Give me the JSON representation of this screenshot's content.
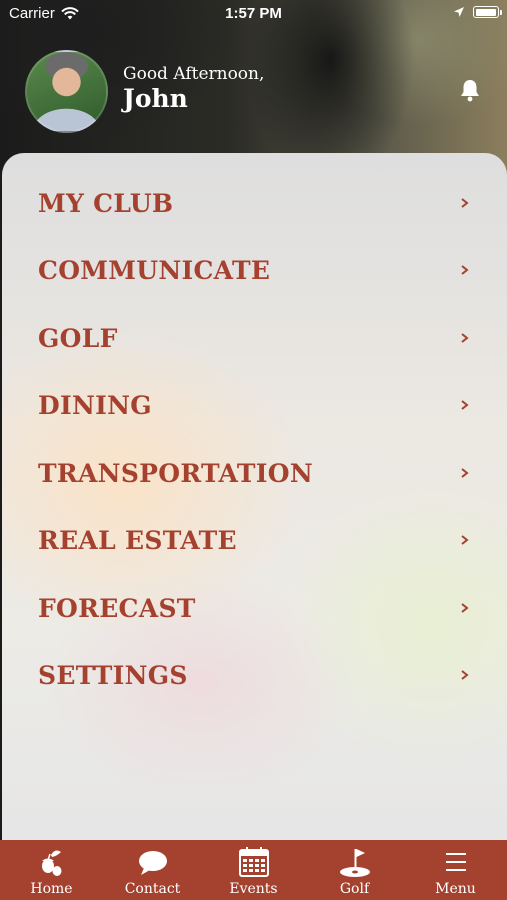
{
  "status_bar": {
    "carrier": "Carrier",
    "time": "1:57 PM"
  },
  "header": {
    "greeting": "Good Afternoon,",
    "user_name": "John"
  },
  "menu": {
    "items": [
      {
        "label": "MY CLUB"
      },
      {
        "label": "COMMUNICATE"
      },
      {
        "label": "GOLF"
      },
      {
        "label": "DINING"
      },
      {
        "label": "TRANSPORTATION"
      },
      {
        "label": "REAL ESTATE"
      },
      {
        "label": "FORECAST"
      },
      {
        "label": "SETTINGS"
      }
    ]
  },
  "tabbar": {
    "tabs": [
      {
        "label": "Home",
        "icon": "home-acorn-icon"
      },
      {
        "label": "Contact",
        "icon": "chat-bubble-icon"
      },
      {
        "label": "Events",
        "icon": "calendar-icon"
      },
      {
        "label": "Golf",
        "icon": "golf-flag-icon"
      },
      {
        "label": "Menu",
        "icon": "hamburger-menu-icon"
      }
    ]
  },
  "colors": {
    "accent": "#a5412f",
    "panel": "#e8e6e2",
    "text_light": "#ffffff"
  }
}
